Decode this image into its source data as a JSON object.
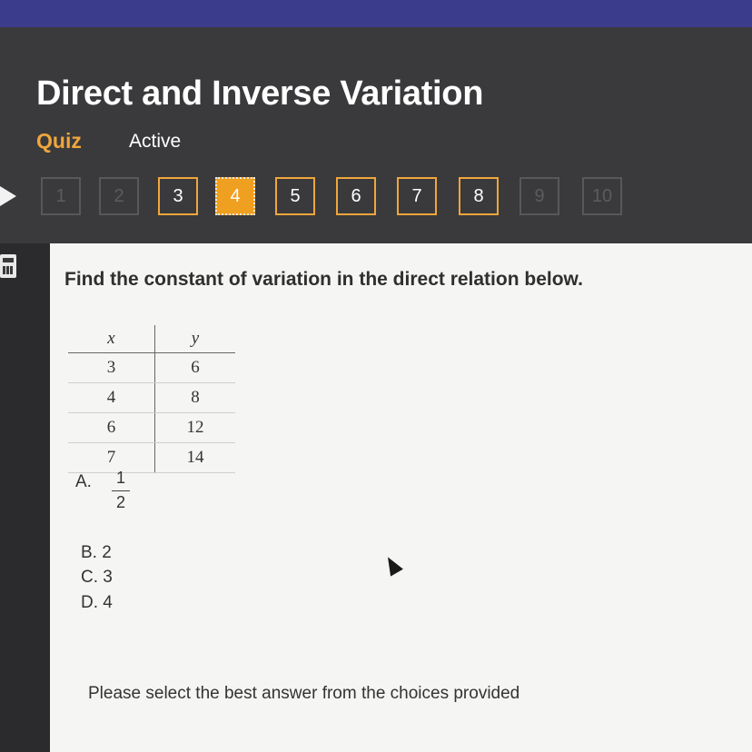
{
  "header": {
    "title": "Direct and Inverse Variation",
    "quiz_label": "Quiz",
    "status": "Active"
  },
  "question_nav": [
    {
      "label": "1",
      "state": "disabled"
    },
    {
      "label": "2",
      "state": "disabled"
    },
    {
      "label": "3",
      "state": "available"
    },
    {
      "label": "4",
      "state": "current"
    },
    {
      "label": "5",
      "state": "available"
    },
    {
      "label": "6",
      "state": "available"
    },
    {
      "label": "7",
      "state": "available"
    },
    {
      "label": "8",
      "state": "available"
    },
    {
      "label": "9",
      "state": "disabled"
    },
    {
      "label": "10",
      "state": "disabled"
    }
  ],
  "question": {
    "prompt": "Find the constant of variation in the direct relation below.",
    "table": {
      "headers": [
        "x",
        "y"
      ],
      "rows": [
        [
          "3",
          "6"
        ],
        [
          "4",
          "8"
        ],
        [
          "6",
          "12"
        ],
        [
          "7",
          "14"
        ]
      ]
    },
    "choices": {
      "a_letter": "A.",
      "a_numerator": "1",
      "a_denominator": "2",
      "b": "B.  2",
      "c": "C.  3",
      "d": "D.  4"
    },
    "instruction": "Please select the best answer from the choices provided"
  },
  "colors": {
    "accent": "#f0a63c",
    "current_question": "#f0a020",
    "header_bg": "#3a3a3c",
    "top_bar": "#3c3c8c",
    "content_bg": "#f5f5f3"
  },
  "icons": [
    "back-arrow-icon",
    "calculator-icon",
    "mouse-pointer-icon"
  ]
}
